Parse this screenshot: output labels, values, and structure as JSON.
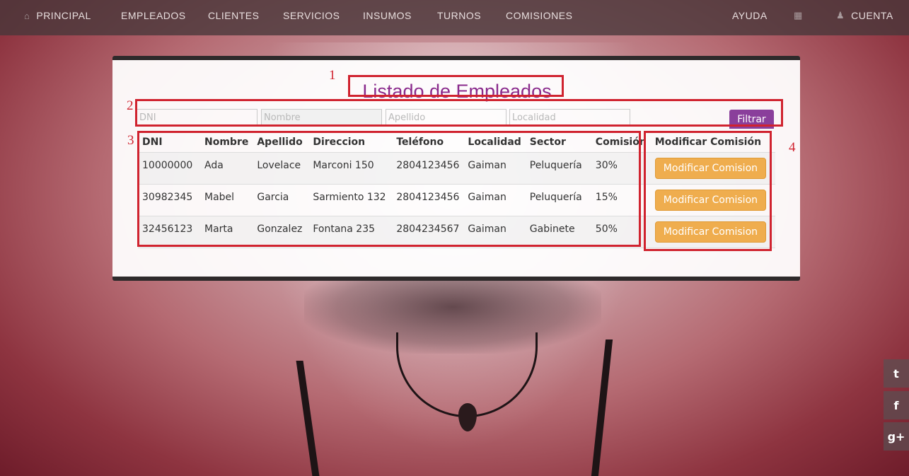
{
  "nav": {
    "home": "PRINCIPAL",
    "employees": "EMPLEADOS",
    "clients": "CLIENTES",
    "services": "SERVICIOS",
    "supplies": "INSUMOS",
    "shifts": "TURNOS",
    "commissions": "COMISIONES",
    "help": "AYUDA",
    "account": "CUENTA"
  },
  "icons": {
    "home": "home-icon",
    "calendar": "calendar-icon",
    "user": "user-icon",
    "twitter": "twitter-icon",
    "facebook": "facebook-icon",
    "googleplus": "googleplus-icon"
  },
  "title": "Listado de Empleados",
  "filters": {
    "dni_placeholder": "DNI",
    "nombre_placeholder": "Nombre",
    "apellido_placeholder": "Apellido",
    "localidad_placeholder": "Localidad",
    "button": "Filtrar"
  },
  "table": {
    "headers": [
      "DNI",
      "Nombre",
      "Apellido",
      "Direccion",
      "Teléfono",
      "Localidad",
      "Sector",
      "Comisión",
      "Modificar Comisión"
    ],
    "rows": [
      [
        "10000000",
        "Ada",
        "Lovelace",
        "Marconi 150",
        "2804123456",
        "Gaiman",
        "Peluquería",
        "30%"
      ],
      [
        "30982345",
        "Mabel",
        "Garcia",
        "Sarmiento 132",
        "2804123456",
        "Gaiman",
        "Peluquería",
        "15%"
      ],
      [
        "32456123",
        "Marta",
        "Gonzalez",
        "Fontana 235",
        "2804234567",
        "Gaiman",
        "Gabinete",
        "50%"
      ]
    ],
    "action_label": "Modificar Comision"
  },
  "annotations": [
    "1",
    "2",
    "3",
    "4"
  ],
  "social": {
    "twitter": "t",
    "facebook": "f",
    "googleplus": "g+"
  },
  "colors": {
    "title": "#8a2a8c",
    "filter_button": "#8a3f9b",
    "action_button": "#efad4e",
    "annotation": "#d0232f"
  }
}
